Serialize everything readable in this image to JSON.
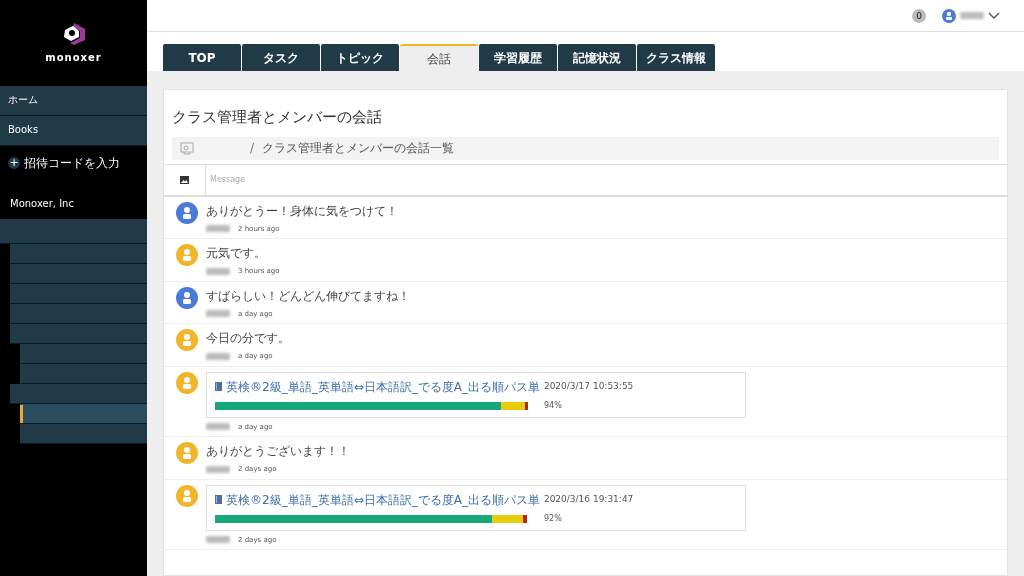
{
  "brand": "monoxer",
  "sidebar": {
    "items": [
      {
        "label": "ホーム",
        "selected": false
      },
      {
        "label": "Books",
        "selected": false
      }
    ],
    "invite": {
      "icon": "+",
      "label": "招待コードを入力"
    },
    "org": "Monoxer, Inc",
    "tree": [
      {
        "selected": false,
        "children": [
          {
            "selected": false
          },
          {
            "selected": false
          },
          {
            "selected": false
          },
          {
            "selected": false
          },
          {
            "selected": false,
            "children": [
              {
                "selected": false
              },
              {
                "selected": false
              }
            ]
          },
          {
            "selected": false,
            "children": [
              {
                "selected": true
              },
              {
                "selected": false
              }
            ]
          }
        ]
      }
    ]
  },
  "header": {
    "notifications": "0"
  },
  "tabs": [
    {
      "label": "TOP",
      "selected": false
    },
    {
      "label": "タスク",
      "selected": false
    },
    {
      "label": "トピック",
      "selected": false
    },
    {
      "label": "会話",
      "selected": true
    },
    {
      "label": "学習履歴",
      "selected": false
    },
    {
      "label": "記憶状況",
      "selected": false
    },
    {
      "label": "クラス情報",
      "selected": false
    }
  ],
  "title": "クラス管理者とメンバーの会話",
  "breadcrumb": {
    "separator": "/",
    "current": "クラス管理者とメンバーの会話一覧"
  },
  "composer": {
    "placeholder": "Message"
  },
  "messages": [
    {
      "kind": "text",
      "color": "#4a7bd8",
      "text": "ありがとうー！身体に気をつけて！",
      "time": "2 hours ago"
    },
    {
      "kind": "text",
      "color": "#f0b52a",
      "text": "元気です。",
      "time": "3 hours ago"
    },
    {
      "kind": "text",
      "color": "#4a7bd8",
      "text": "すばらしい！どんどん伸びてますね！",
      "time": "a day ago"
    },
    {
      "kind": "text",
      "color": "#f0b52a",
      "text": "今日の分です。",
      "time": "a day ago"
    },
    {
      "kind": "record",
      "color": "#f0b52a",
      "book": "英検®2級_単語_英単語⇔日本語訳_でる度A_出る順パス単",
      "date": "2020/3/17 10:53:55",
      "segments": [
        {
          "color": "#17a77a",
          "level": 0.915
        },
        {
          "color": "#e8cc0a",
          "level": 0.075
        },
        {
          "color": "#b02a1a",
          "level": 0.01
        }
      ],
      "percent": "94%",
      "time": "a day ago"
    },
    {
      "kind": "text",
      "color": "#f0b52a",
      "text": "ありがとうございます！！",
      "time": "2 days ago"
    },
    {
      "kind": "record",
      "color": "#f0b52a",
      "book": "英検®2級_単語_英単語⇔日本語訳_でる度A_出る順パス単",
      "date": "2020/3/16 19:31:47",
      "segments": [
        {
          "color": "#17a77a",
          "level": 0.885
        },
        {
          "color": "#e8cc0a",
          "level": 0.1
        },
        {
          "color": "#b02a1a",
          "level": 0.012
        }
      ],
      "percent": "92%",
      "time": "2 days ago"
    }
  ]
}
